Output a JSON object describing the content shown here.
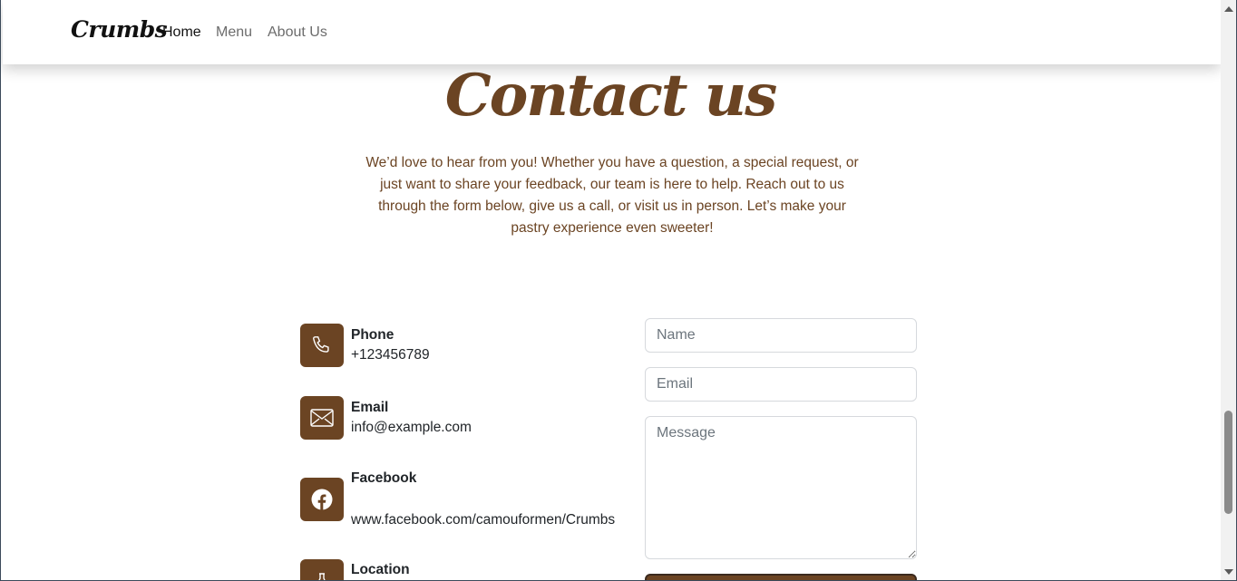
{
  "nav": {
    "brand": "Crumbs",
    "links": [
      "Home",
      "Menu",
      "About Us"
    ]
  },
  "page": {
    "title": "Contact us",
    "intro": "We’d love to hear from you! Whether you have a question, a special request, or just want to share your feedback, our team is here to help. Reach out to us through the form below, give us a call, or visit us in person. Let’s make your pastry experience even sweeter!"
  },
  "contact": {
    "phone": {
      "label": "Phone",
      "value": "+123456789",
      "icon": "phone-icon"
    },
    "email": {
      "label": "Email",
      "value": "info@example.com",
      "icon": "envelope-icon"
    },
    "facebook": {
      "label": "Facebook",
      "value": "www.facebook.com/camouformen/Crumbs",
      "icon": "facebook-icon"
    },
    "location": {
      "label": "Location",
      "icon": "location-icon"
    }
  },
  "form": {
    "name_placeholder": "Name",
    "email_placeholder": "Email",
    "message_placeholder": "Message"
  },
  "colors": {
    "accent": "#6b4423",
    "text": "#212529",
    "nav_muted": "#6c6c6c"
  }
}
